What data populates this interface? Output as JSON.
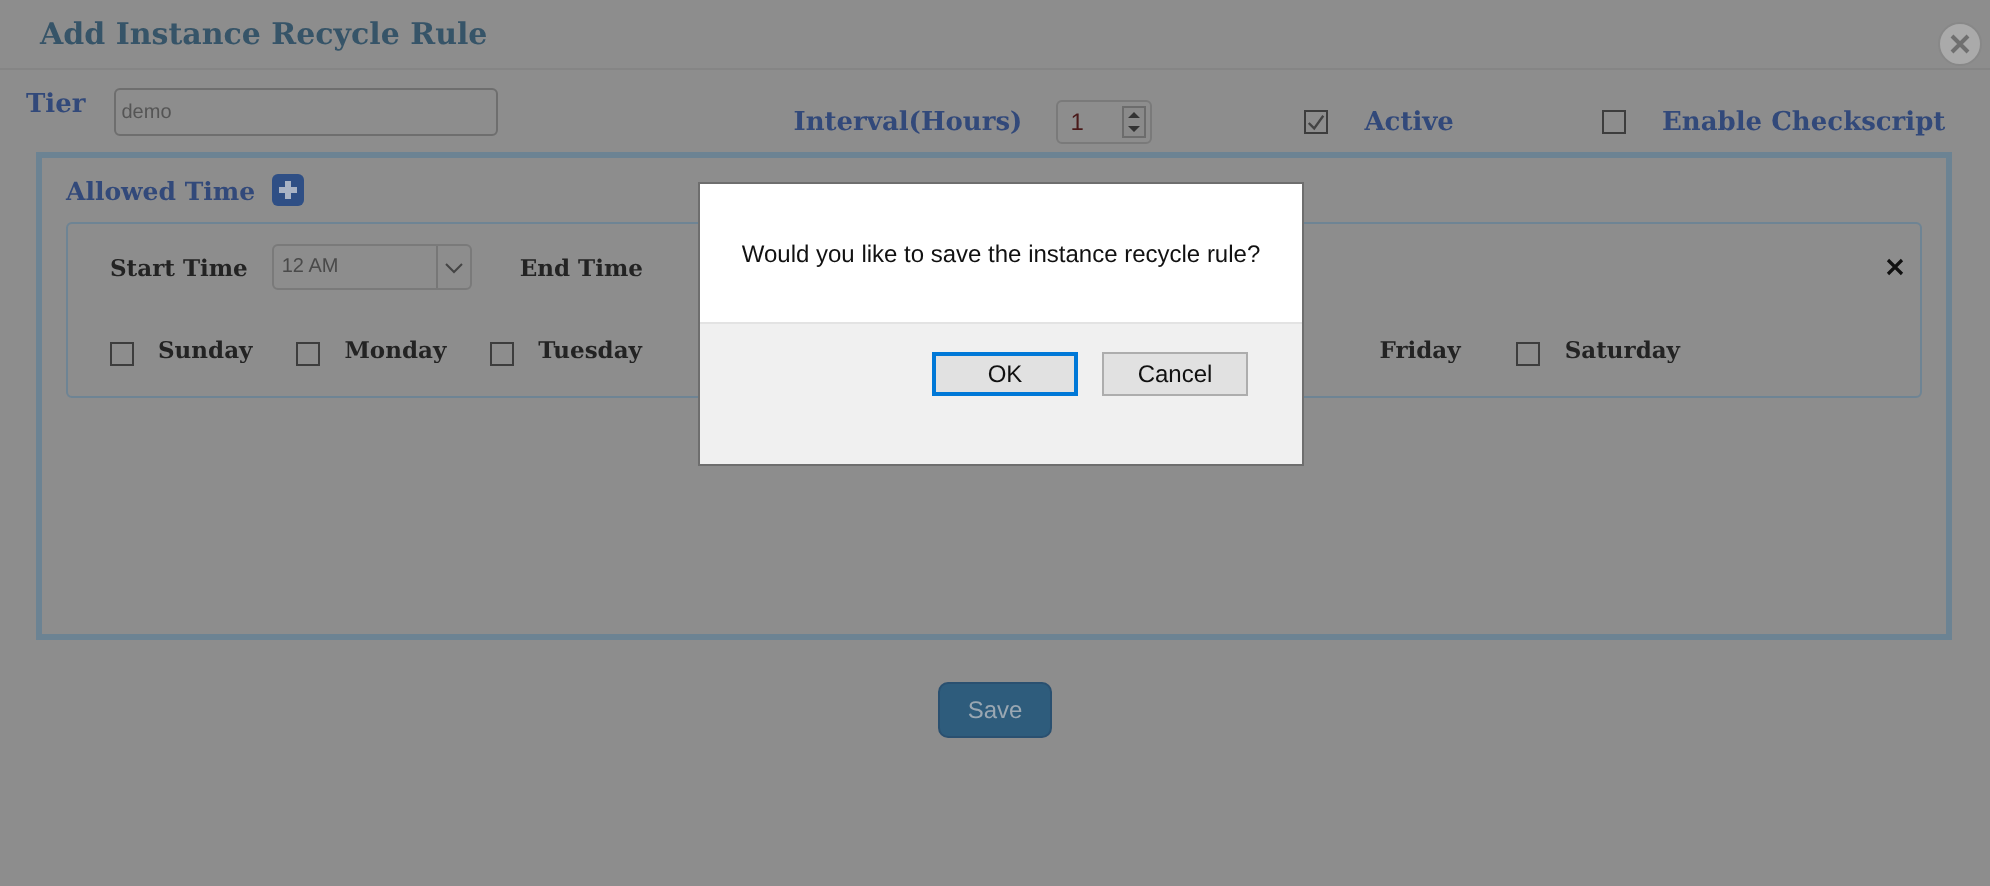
{
  "window": {
    "title": "Add Instance Recycle Rule"
  },
  "tier": {
    "label": "Tier",
    "value": "demo"
  },
  "interval": {
    "label": "Interval(Hours)",
    "value": "1"
  },
  "options": [
    {
      "label": "Active",
      "checked": true
    },
    {
      "label": "Enable Checkscript",
      "checked": false
    }
  ],
  "allowed_time": {
    "label": "Allowed Time",
    "start_label": "Start Time",
    "start_value": "12 AM",
    "end_label": "End Time",
    "days": [
      {
        "label": "Sunday",
        "checked": false
      },
      {
        "label": "Monday",
        "checked": false
      },
      {
        "label": "Tuesday",
        "checked": false
      },
      {
        "label": "Friday"
      },
      {
        "label": "Saturday",
        "checked": false
      }
    ]
  },
  "save_button": "Save",
  "dialog": {
    "message": "Would you like to save the instance recycle rule?",
    "buttons": [
      {
        "label": "OK",
        "selected": true
      },
      {
        "label": "Cancel",
        "selected": false
      }
    ]
  }
}
